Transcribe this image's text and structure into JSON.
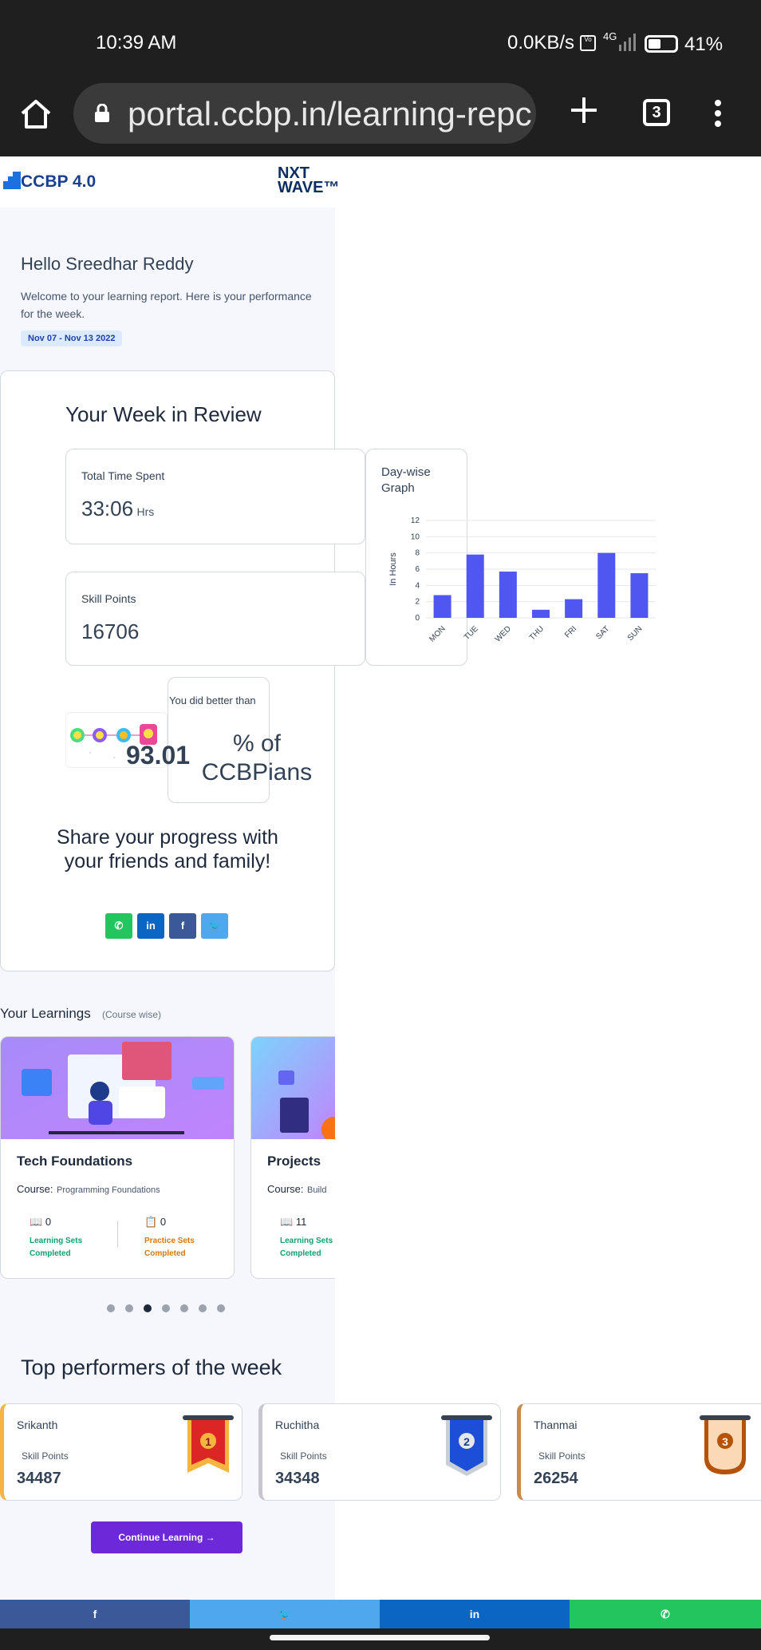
{
  "status_bar": {
    "time": "10:39 AM",
    "network_speed": "0.0KB/s",
    "volte": "Vo LTE",
    "signal": "4G",
    "battery": "41%",
    "battery_level": 0.41
  },
  "browser": {
    "url": "portal.ccbp.in/learning-repc",
    "tab_count": "3"
  },
  "header": {
    "logo_text": "CCBP 4.0",
    "brand_line1": "NXT",
    "brand_line2": "WAVE™"
  },
  "greeting": {
    "hello": "Hello",
    "name": "Sreedhar Reddy",
    "welcome": "Welcome to your learning report. Here is your performance for the week.",
    "date_range": "Nov 07 - Nov 13 2022"
  },
  "review": {
    "title": "Your Week in Review",
    "time_label": "Total Time Spent",
    "time_value": "33:06",
    "time_unit": "Hrs",
    "skill_label": "Skill Points",
    "skill_value": "16706",
    "better_label": "You did better than",
    "better_pct": "93.01",
    "better_suffix": "% of CCBPians",
    "share_text": "Share your progress with your friends and family!"
  },
  "graph": {
    "title": "Day-wise Graph"
  },
  "chart_data": {
    "type": "bar",
    "title": "Day-wise Graph",
    "categories": [
      "MON",
      "TUE",
      "WED",
      "THU",
      "FRI",
      "SAT",
      "SUN"
    ],
    "values": [
      2.8,
      7.8,
      5.7,
      1.0,
      2.3,
      8.0,
      5.5
    ],
    "ylabel": "In Hours",
    "xlabel": "",
    "ylim": [
      0,
      12
    ],
    "yticks": [
      "0",
      "2",
      "4",
      "6",
      "8",
      "10",
      "12"
    ],
    "bar_color": "#5057f0",
    "grid": true
  },
  "share_buttons": {
    "whatsapp": "✆",
    "linkedin": "in",
    "facebook": "f",
    "twitter": "🐦"
  },
  "learnings": {
    "title": "Your Learnings",
    "subtitle": "(Course wise)",
    "courses": [
      {
        "name": "Tech Foundations",
        "course_label": "Course:",
        "course_value": "Programming Foundations",
        "learning_count": "0",
        "learning_label": "Learning Sets Completed",
        "practice_count": "0",
        "practice_label": "Practice Sets Completed"
      },
      {
        "name": "Projects",
        "course_label": "Course:",
        "course_value": "Build",
        "learning_count": "11",
        "learning_label": "Learning Sets Completed"
      }
    ]
  },
  "carousel": {
    "count": 7,
    "active_index": 2
  },
  "top_performers": {
    "title": "Top performers of the week",
    "points_label": "Skill Points",
    "list": [
      {
        "name": "Srikanth",
        "points": "34487",
        "rank": "1",
        "accent": "#f5b53f"
      },
      {
        "name": "Ruchitha",
        "points": "34348",
        "rank": "2",
        "accent": "#c9c5cf"
      },
      {
        "name": "Thanmai",
        "points": "26254",
        "rank": "3",
        "accent": "#c98a4b"
      }
    ]
  },
  "cta": {
    "label": "Continue Learning  →"
  },
  "bottom_share": {
    "facebook": "f",
    "twitter": "🐦",
    "linkedin": "in",
    "whatsapp": "✆"
  }
}
